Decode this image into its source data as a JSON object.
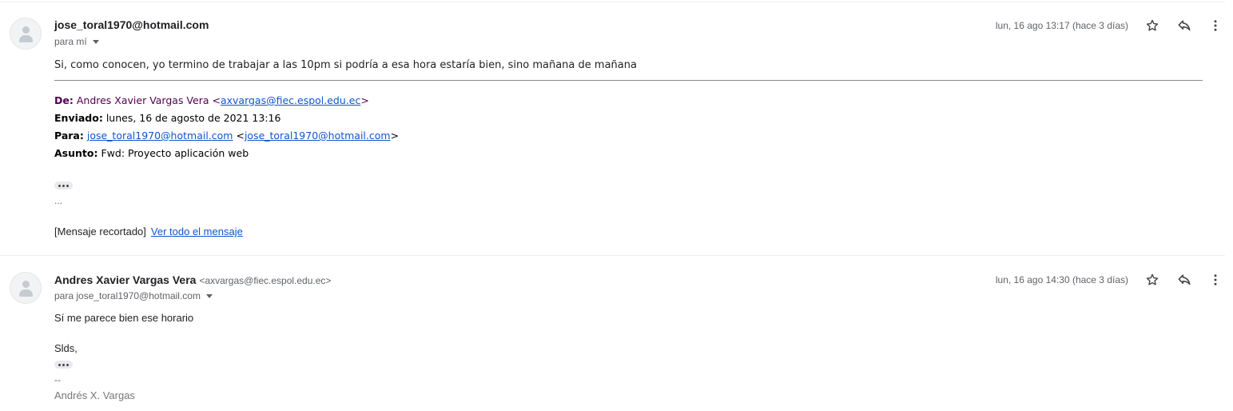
{
  "messages": [
    {
      "sender_name": "jose_toral1970@hotmail.com",
      "sender_email": "",
      "recipients": "para mí",
      "date": "lun, 16 ago 13:17 (hace 3 días)",
      "body": "Si, como conocen, yo termino de trabajar a las 10pm si podría a esa hora estaría bien, sino mañana de mañana",
      "forward": {
        "from_label": "De:",
        "from_name": "Andres Xavier Vargas Vera",
        "from_email": "axvargas@fiec.espol.edu.ec",
        "sent_label": "Enviado:",
        "sent_value": "lunes, 16 de agosto de 2021 13:16",
        "to_label": "Para:",
        "to_link": "jose_toral1970@hotmail.com",
        "to_email": "jose_toral1970@hotmail.com",
        "subject_label": "Asunto:",
        "subject_value": "Fwd: Proyecto aplicación web"
      },
      "ellipsis_text": "...",
      "clipped_text": "[Mensaje recortado]",
      "view_all_link": "Ver todo el mensaje"
    },
    {
      "sender_name": "Andres Xavier Vargas Vera",
      "sender_email": "<axvargas@fiec.espol.edu.ec>",
      "recipients": "para jose_toral1970@hotmail.com",
      "date": "lun, 16 ago 14:30 (hace 3 días)",
      "body_line1": "Sí me parece bien ese horario",
      "body_line2": "Slds,",
      "sig_dashes": "--",
      "sig_name": "Andrés X. Vargas"
    }
  ],
  "icons": {
    "star": "star-icon",
    "reply": "reply-icon",
    "more": "more-vert-icon",
    "avatar": "default-avatar-icon",
    "expand": "show-trimmed-content-icon"
  },
  "colors": {
    "link": "#1155cc",
    "forward_from": "#500050",
    "meta_grey": "#5f6368"
  }
}
